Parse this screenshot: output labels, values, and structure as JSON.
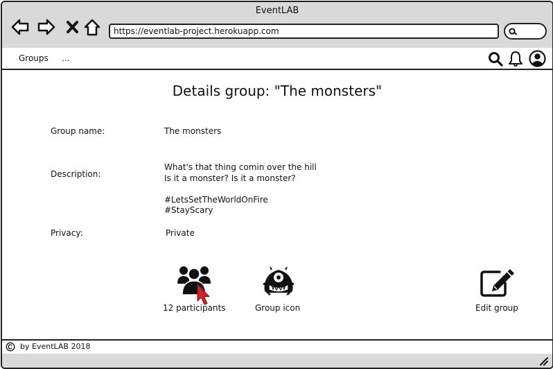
{
  "window": {
    "title": "EventLAB"
  },
  "browser": {
    "url": "https://eventlab-project.herokuapp.com",
    "icons": [
      "back-arrow-icon",
      "forward-arrow-icon",
      "close-x-icon",
      "home-icon",
      "search-icon"
    ]
  },
  "menu": {
    "items": [
      {
        "label": "Groups"
      },
      {
        "label": "..."
      }
    ],
    "icons": [
      "search-icon",
      "bell-icon",
      "user-avatar-icon"
    ]
  },
  "page": {
    "title": "Details group: \"The monsters\"",
    "fields": {
      "group_name": {
        "label": "Group name:",
        "value": "The monsters"
      },
      "description": {
        "label": "Description:",
        "lines": [
          "What's that thing comin over the hill",
          "Is it a monster? Is it a monster?",
          "#LetsSetTheWorldOnFire",
          "#StayScary"
        ]
      },
      "privacy": {
        "label": "Privacy:",
        "value": "Private"
      }
    },
    "actions": {
      "participants": {
        "label": "12 participants",
        "icon": "group-people-icon"
      },
      "group_icon": {
        "label": "Group icon",
        "icon": "monster-icon"
      },
      "edit": {
        "label": "Edit group",
        "icon": "edit-pencil-icon"
      }
    }
  },
  "footer": {
    "text": "by EventLAB 2018",
    "icon": "copyright-icon"
  },
  "colors": {
    "cursor": "#d32027",
    "frame": "#222222",
    "chrome": "#d9d9d9"
  }
}
